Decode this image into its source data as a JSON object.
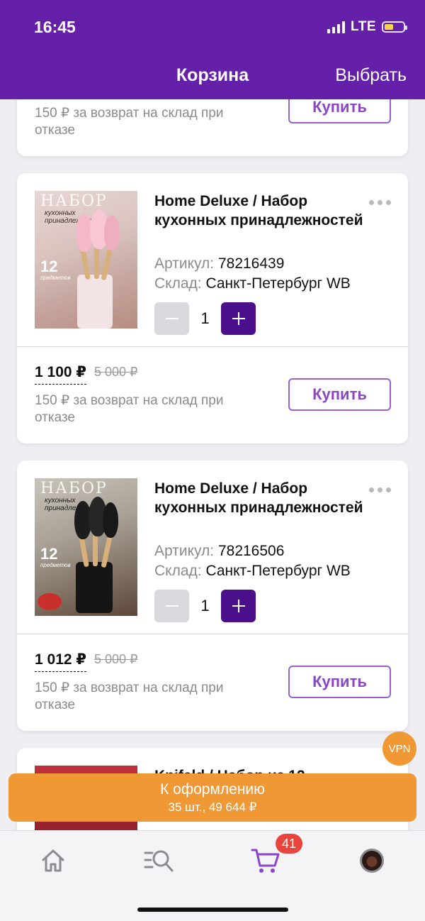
{
  "status_bar": {
    "time": "16:45",
    "network": "LTE"
  },
  "nav": {
    "title": "Корзина",
    "action": "Выбрать"
  },
  "partial_card": {
    "return_note": "150 ₽ за возврат на склад при отказе",
    "buy_label": "Купить"
  },
  "products": [
    {
      "image": {
        "title": "НАБОР",
        "subtitle": "кухонных принадлежностей",
        "count": "12",
        "count_sub": "предметов"
      },
      "name": "Home Deluxe / Набор кухонных принадлежностей",
      "article_label": "Артикул:",
      "article": "78216439",
      "warehouse_label": "Склад:",
      "warehouse": "Санкт-Петербург WB",
      "qty": "1",
      "price": "1 100 ₽",
      "old_price": "5 000 ₽",
      "return_note": "150 ₽ за возврат на склад при отказе",
      "buy_label": "Купить"
    },
    {
      "image": {
        "title": "НАБОР",
        "subtitle": "кухонных принадлежностей",
        "count": "12",
        "count_sub": "предметов"
      },
      "name": "Home Deluxe / Набор кухонных принадлежностей",
      "article_label": "Артикул:",
      "article": "78216506",
      "warehouse_label": "Склад:",
      "warehouse": "Санкт-Петербург WB",
      "qty": "1",
      "price": "1 012 ₽",
      "old_price": "5 000 ₽",
      "return_note": "150 ₽ за возврат на склад при отказе",
      "buy_label": "Купить"
    }
  ],
  "next_card_peek": {
    "name_fragment": "Knifeld / Набор из 12"
  },
  "checkout": {
    "label": "К оформлению",
    "summary": "35 шт., 49 644 ₽"
  },
  "vpn_badge": "VPN",
  "tabbar": {
    "items": [
      {
        "name": "home",
        "icon": "home-icon"
      },
      {
        "name": "catalog",
        "icon": "search-list-icon"
      },
      {
        "name": "cart",
        "icon": "cart-icon"
      },
      {
        "name": "profile",
        "icon": "avatar-icon"
      }
    ],
    "cart_badge": "41"
  },
  "colors": {
    "brand": "#6520a9",
    "accent": "#f09934",
    "plus_button": "#4b0f8c",
    "badge": "#e8453f"
  }
}
